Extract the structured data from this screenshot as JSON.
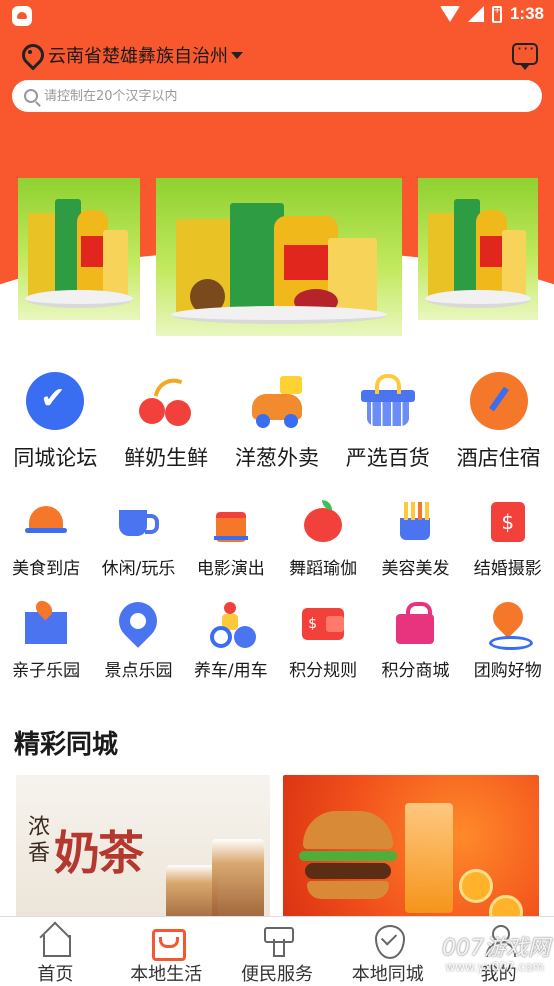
{
  "status_bar": {
    "time": "1:38"
  },
  "header": {
    "location": "云南省楚雄彝族自治州",
    "search_placeholder": "请控制在20个汉字以内"
  },
  "categories_main": [
    {
      "label": "同城论坛",
      "icon": "forum-icon"
    },
    {
      "label": "鲜奶生鲜",
      "icon": "cherry-icon"
    },
    {
      "label": "洋葱外卖",
      "icon": "scooter-icon"
    },
    {
      "label": "严选百货",
      "icon": "basket-icon"
    },
    {
      "label": "酒店住宿",
      "icon": "compass-icon"
    }
  ],
  "categories_row2": [
    {
      "label": "美食到店",
      "icon": "food-tray-icon"
    },
    {
      "label": "休闲/玩乐",
      "icon": "coffee-cup-icon"
    },
    {
      "label": "电影演出",
      "icon": "movie-icon"
    },
    {
      "label": "舞蹈瑜伽",
      "icon": "apple-icon"
    },
    {
      "label": "美容美发",
      "icon": "fries-icon"
    },
    {
      "label": "结婚摄影",
      "icon": "red-packet-icon"
    }
  ],
  "categories_row3": [
    {
      "label": "亲子乐园",
      "icon": "map-icon"
    },
    {
      "label": "景点乐园",
      "icon": "location-bubble-icon"
    },
    {
      "label": "养车/用车",
      "icon": "bike-icon"
    },
    {
      "label": "积分规则",
      "icon": "wallet-icon"
    },
    {
      "label": "积分商城",
      "icon": "shopping-bag-icon"
    },
    {
      "label": "团购好物",
      "icon": "locate-icon"
    }
  ],
  "section": {
    "title": "精彩同城",
    "cards": [
      {
        "text_small": "浓香",
        "text_big": "奶茶"
      },
      {
        "text_small": "",
        "text_big": ""
      }
    ]
  },
  "bottom_nav": [
    {
      "label": "首页",
      "icon": "home-icon"
    },
    {
      "label": "本地生活",
      "icon": "shopping-bag-icon"
    },
    {
      "label": "便民服务",
      "icon": "service-icon"
    },
    {
      "label": "本地同城",
      "icon": "check-badge-icon"
    },
    {
      "label": "我的",
      "icon": "user-icon"
    }
  ],
  "watermark": {
    "text": "007游戏网",
    "url": "www.yx007.com"
  },
  "colors": {
    "brand": "#f9582f",
    "accent_blue": "#3a6ef2"
  }
}
